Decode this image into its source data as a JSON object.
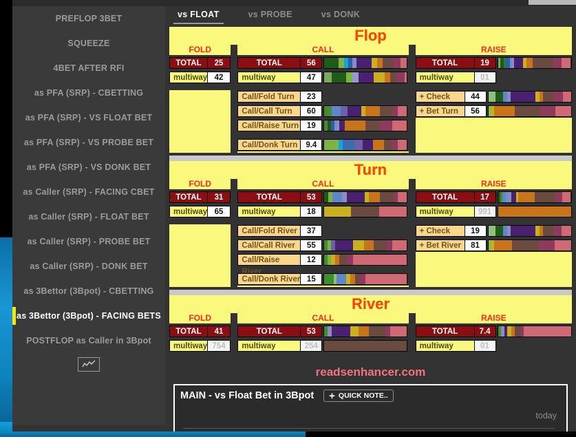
{
  "window": {
    "title": "readsenhancer"
  },
  "sidebar": {
    "items": [
      {
        "label": "PREFLOP 3BET",
        "active": false
      },
      {
        "label": "SQUEEZE",
        "active": false
      },
      {
        "label": "4BET AFTER RFI",
        "active": false
      },
      {
        "label": "as PFA (SRP) - CBETTING",
        "active": false
      },
      {
        "label": "as PFA (SRP) - VS FLOAT BET",
        "active": false
      },
      {
        "label": "as PFA (SRP) - VS PROBE BET",
        "active": false
      },
      {
        "label": "as PFA (SRP) - VS DONK BET",
        "active": false
      },
      {
        "label": "as Caller (SRP) - FACING CBET",
        "active": false
      },
      {
        "label": "as Caller (SRP) - FLOAT BET",
        "active": false
      },
      {
        "label": "as Caller (SRP) - PROBE BET",
        "active": false
      },
      {
        "label": "as Caller (SRP) - DONK BET",
        "active": false
      },
      {
        "label": "as 3Bettor (3Bpot) - CBETTING",
        "active": false
      },
      {
        "label": "as 3Bettor (3Bpot) - FACING BETS",
        "active": true
      },
      {
        "label": "POSTFLOP as Caller in 3Bpot",
        "active": false
      }
    ],
    "chart_button": "chart-icon"
  },
  "tabs": [
    {
      "label": "vs FLOAT",
      "active": true
    },
    {
      "label": "vs PROBE",
      "active": false
    },
    {
      "label": "vs DONK",
      "active": false
    }
  ],
  "colors": {
    "panel_yellow": "#fbf87e",
    "title_orange": "#ff4500",
    "col_header_red": "#ff2a1a",
    "total_dark_red": "#8b0f12",
    "tan_label": "#fcd68a",
    "accent_yellow": "#f2e70a",
    "brand_pink": "#f2737d"
  },
  "streets": [
    {
      "title": "Flop",
      "columns": {
        "fold": "FOLD",
        "call": "CALL",
        "raise": "RAISE"
      },
      "fold": [
        {
          "label": "TOTAL",
          "value": "25",
          "kind": "total",
          "bar": []
        },
        {
          "label": "multiway",
          "value": "42",
          "kind": "multi",
          "bar": []
        }
      ],
      "call": [
        {
          "label": "TOTAL",
          "value": "56",
          "kind": "total",
          "bar": [
            [
              "#1e5c18",
              17
            ],
            [
              "#7cb342",
              7
            ],
            [
              "#16a3dc",
              5
            ],
            [
              "#2f5fa8",
              5
            ],
            [
              "#8e8bc4",
              5
            ],
            [
              "#4a2170",
              18
            ],
            [
              "#c9b01c",
              7
            ],
            [
              "#c8741a",
              7
            ],
            [
              "#6b4a3f",
              12
            ],
            [
              "#8e3a5c",
              9
            ],
            [
              "#cf6a74",
              8
            ]
          ]
        },
        {
          "label": "multiway",
          "value": "47",
          "kind": "multi",
          "bar": [
            [
              "#7aab5c",
              9
            ],
            [
              "#1e5c18",
              17
            ],
            [
              "#7cb342",
              8
            ],
            [
              "#9b94cf",
              7
            ],
            [
              "#4a2170",
              19
            ],
            [
              "#c9b01c",
              13
            ],
            [
              "#c8741a",
              7
            ],
            [
              "#6b4a3f",
              7
            ],
            [
              "#8e3a5c",
              10
            ],
            [
              "#cf6a74",
              3
            ]
          ]
        }
      ],
      "raise": [
        {
          "label": "TOTAL",
          "value": "19",
          "kind": "total",
          "bar": [
            [
              "#7aab5c",
              3
            ],
            [
              "#1e5c18",
              5
            ],
            [
              "#2f7d2a",
              3
            ],
            [
              "#2f5fa8",
              5
            ],
            [
              "#6f8fcf",
              3
            ],
            [
              "#8e8bc4",
              3
            ],
            [
              "#4a2170",
              12
            ],
            [
              "#c9b01c",
              5
            ],
            [
              "#c8741a",
              9
            ],
            [
              "#6b4a3f",
              28
            ],
            [
              "#8e3a5c",
              11
            ],
            [
              "#cf6a74",
              13
            ]
          ]
        },
        {
          "label": "multiway",
          "value": "01",
          "kind": "multi",
          "faint": true,
          "bar": []
        }
      ],
      "call_sub": [
        {
          "label": "Call/Fold Turn",
          "value": "23",
          "bar": []
        },
        {
          "label": "Call/Call Turn",
          "value": "60",
          "bar": [
            [
              "#4a8a2a",
              5
            ],
            [
              "#3f8f3a",
              4
            ],
            [
              "#5f86c8",
              11
            ],
            [
              "#6f5fa8",
              8
            ],
            [
              "#4a2170",
              17
            ],
            [
              "#c9b01c",
              5
            ],
            [
              "#c8741a",
              17
            ],
            [
              "#6b4a3f",
              15
            ],
            [
              "#8e3a5c",
              7
            ],
            [
              "#cf6a74",
              11
            ]
          ]
        },
        {
          "label": "Call/Raise Turn",
          "value": "19",
          "bar": [
            [
              "#4a8a2a",
              4
            ],
            [
              "#1e5c18",
              4
            ],
            [
              "#2f5fa8",
              4
            ],
            [
              "#6f8fcf",
              3
            ],
            [
              "#8e8bc4",
              3
            ],
            [
              "#4a2170",
              7
            ],
            [
              "#c8741a",
              25
            ],
            [
              "#6b4a3f",
              17
            ],
            [
              "#8e3a5c",
              15
            ],
            [
              "#cf6a74",
              18
            ]
          ]
        }
      ],
      "call_sub2": [
        {
          "label": "Call/Donk Turn",
          "value": "9.4",
          "bar": [
            [
              "#7cb342",
              17
            ],
            [
              "#16a3dc",
              5
            ],
            [
              "#3f6cb0",
              15
            ],
            [
              "#6f5fa8",
              9
            ],
            [
              "#4a2170",
              13
            ],
            [
              "#c8741a",
              13
            ],
            [
              "#6b4a3f",
              9
            ],
            [
              "#8e3a5c",
              8
            ],
            [
              "#cf6a74",
              11
            ]
          ]
        }
      ],
      "raise_sub": [
        {
          "label": "+ Check Turn",
          "value": "44",
          "bar": [
            [
              "#8fc07a",
              9
            ],
            [
              "#1e5c18",
              9
            ],
            [
              "#5f86c8",
              5
            ],
            [
              "#8e8bc4",
              4
            ],
            [
              "#4a2170",
              30
            ],
            [
              "#c9b01c",
              5
            ],
            [
              "#c8741a",
              4
            ],
            [
              "#6b4a3f",
              13
            ],
            [
              "#8e3a5c",
              11
            ],
            [
              "#cf6a74",
              10
            ]
          ]
        },
        {
          "label": "+ Bet Turn",
          "value": "56",
          "bar": [
            [
              "#8fc03a",
              4
            ],
            [
              "#c9b01c",
              3
            ],
            [
              "#c8741a",
              25
            ],
            [
              "#6b4a3f",
              30
            ],
            [
              "#8e3a5c",
              19
            ],
            [
              "#cf6a74",
              19
            ]
          ]
        }
      ]
    },
    {
      "title": "Turn",
      "columns": {
        "fold": "FOLD",
        "call": "CALL",
        "raise": "RAISE"
      },
      "fold": [
        {
          "label": "TOTAL",
          "value": "31",
          "kind": "total",
          "bar": []
        },
        {
          "label": "multiway",
          "value": "65",
          "kind": "multi",
          "bar": []
        }
      ],
      "call": [
        {
          "label": "TOTAL",
          "value": "53",
          "kind": "total",
          "bar": [
            [
              "#1e5c18",
              5
            ],
            [
              "#7cb342",
              5
            ],
            [
              "#5f86c8",
              11
            ],
            [
              "#8e8bc4",
              6
            ],
            [
              "#4a2170",
              22
            ],
            [
              "#c9b01c",
              5
            ],
            [
              "#c8741a",
              13
            ],
            [
              "#6b4a3f",
              17
            ],
            [
              "#8e3a5c",
              5
            ],
            [
              "#cf6a74",
              11
            ]
          ]
        },
        {
          "label": "multiway",
          "value": "18",
          "kind": "multi",
          "bar": [
            [
              "#c9b01c",
              32
            ],
            [
              "#6b4a3f",
              34
            ],
            [
              "#cf6a74",
              34
            ]
          ]
        }
      ],
      "raise": [
        {
          "label": "TOTAL",
          "value": "17",
          "kind": "total",
          "bar": [
            [
              "#1e5c18",
              3
            ],
            [
              "#4a8a2a",
              3
            ],
            [
              "#5f86c8",
              5
            ],
            [
              "#6f8fcf",
              4
            ],
            [
              "#8e8bc4",
              3
            ],
            [
              "#4a2170",
              7
            ],
            [
              "#c9b01c",
              3
            ],
            [
              "#c8741a",
              22
            ],
            [
              "#6b4a3f",
              29
            ],
            [
              "#8e3a5c",
              9
            ],
            [
              "#cf6a74",
              12
            ]
          ]
        },
        {
          "label": "multiway",
          "value": "991",
          "kind": "multi",
          "faint": true,
          "bar": [
            [
              "#c8741a",
              100
            ]
          ]
        }
      ],
      "call_sub": [
        {
          "label": "Call/Fold River",
          "value": "37",
          "bar": []
        },
        {
          "label": "Call/Call River",
          "value": "55",
          "bar": [
            [
              "#3f8f2a",
              4
            ],
            [
              "#7cb342",
              4
            ],
            [
              "#6f5fa8",
              5
            ],
            [
              "#4a2170",
              22
            ],
            [
              "#c9b01c",
              13
            ],
            [
              "#c8741a",
              12
            ],
            [
              "#6b4a3f",
              16
            ],
            [
              "#8e3a5c",
              6
            ],
            [
              "#cf6a74",
              18
            ]
          ]
        },
        {
          "label": "Call/Raise River",
          "value": "12",
          "bar": [
            [
              "#3f8f2a",
              4
            ],
            [
              "#7cb342",
              4
            ],
            [
              "#c9b01c",
              5
            ],
            [
              "#c8741a",
              5
            ],
            [
              "#6b4a3f",
              9
            ],
            [
              "#8e3a5c",
              8
            ],
            [
              "#cf6a74",
              65
            ]
          ]
        }
      ],
      "call_sub2": [
        {
          "label": "Call/Donk River",
          "value": "15",
          "bar": [
            [
              "#3f8f2a",
              11
            ],
            [
              "#8fc07a",
              4
            ],
            [
              "#5f86c8",
              11
            ],
            [
              "#c9b01c",
              5
            ],
            [
              "#c8741a",
              6
            ],
            [
              "#6b4a3f",
              5
            ],
            [
              "#8e3a5c",
              8
            ],
            [
              "#cf6a74",
              50
            ]
          ]
        }
      ],
      "raise_sub": [
        {
          "label": "+ Check River",
          "value": "19",
          "bar": [
            [
              "#8fc07a",
              9
            ],
            [
              "#1e5c18",
              9
            ],
            [
              "#5f86c8",
              5
            ],
            [
              "#8e8bc4",
              4
            ],
            [
              "#4a2170",
              30
            ],
            [
              "#c9b01c",
              5
            ],
            [
              "#c8741a",
              4
            ],
            [
              "#6b4a3f",
              13
            ],
            [
              "#8e3a5c",
              10
            ],
            [
              "#cf6a74",
              11
            ]
          ]
        },
        {
          "label": "+ Bet River",
          "value": "81",
          "bar": [
            [
              "#8fc03a",
              4
            ],
            [
              "#c9b01c",
              3
            ],
            [
              "#c8741a",
              22
            ],
            [
              "#6b4a3f",
              32
            ],
            [
              "#8e3a5c",
              19
            ],
            [
              "#cf6a74",
              20
            ]
          ]
        }
      ]
    },
    {
      "title": "River",
      "columns": {
        "fold": "FOLD",
        "call": "CALL",
        "raise": "RAISE"
      },
      "fold": [
        {
          "label": "TOTAL",
          "value": "41",
          "kind": "total",
          "bar": []
        },
        {
          "label": "multiway",
          "value": "754",
          "kind": "multi",
          "faint": true,
          "bar": []
        }
      ],
      "call": [
        {
          "label": "TOTAL",
          "value": "53",
          "kind": "total",
          "bar": [
            [
              "#3f8f2a",
              4
            ],
            [
              "#8e8bc4",
              5
            ],
            [
              "#4a2170",
              22
            ],
            [
              "#c9b01c",
              10
            ],
            [
              "#c8741a",
              13
            ],
            [
              "#6b4a3f",
              20
            ],
            [
              "#8e3a5c",
              6
            ],
            [
              "#cf6a74",
              20
            ]
          ]
        },
        {
          "label": "multiway",
          "value": "254",
          "kind": "multi",
          "faint": true,
          "bar": [
            [
              "#6b4a3f",
              100
            ]
          ]
        }
      ],
      "raise": [
        {
          "label": "TOTAL",
          "value": "7.4",
          "kind": "total",
          "bar": [
            [
              "#3f8f2a",
              4
            ],
            [
              "#8e8bc4",
              5
            ],
            [
              "#4a2170",
              4
            ],
            [
              "#c9b01c",
              5
            ],
            [
              "#c8741a",
              5
            ],
            [
              "#6b4a3f",
              8
            ],
            [
              "#8e3a5c",
              4
            ],
            [
              "#cf6a74",
              65
            ]
          ]
        },
        {
          "label": "multiway",
          "value": "01",
          "kind": "multi",
          "faint": true,
          "bar": []
        }
      ],
      "call_sub": [],
      "call_sub2": [],
      "raise_sub": []
    }
  ],
  "brand": {
    "text": "readsenhancer.com"
  },
  "notes": {
    "title": "MAIN - vs Float Bet in 3Bpot",
    "quick_note_label": "QUICK NOTE..",
    "quick_note_plus": "+",
    "timestamp": "today",
    "body_value": ""
  }
}
